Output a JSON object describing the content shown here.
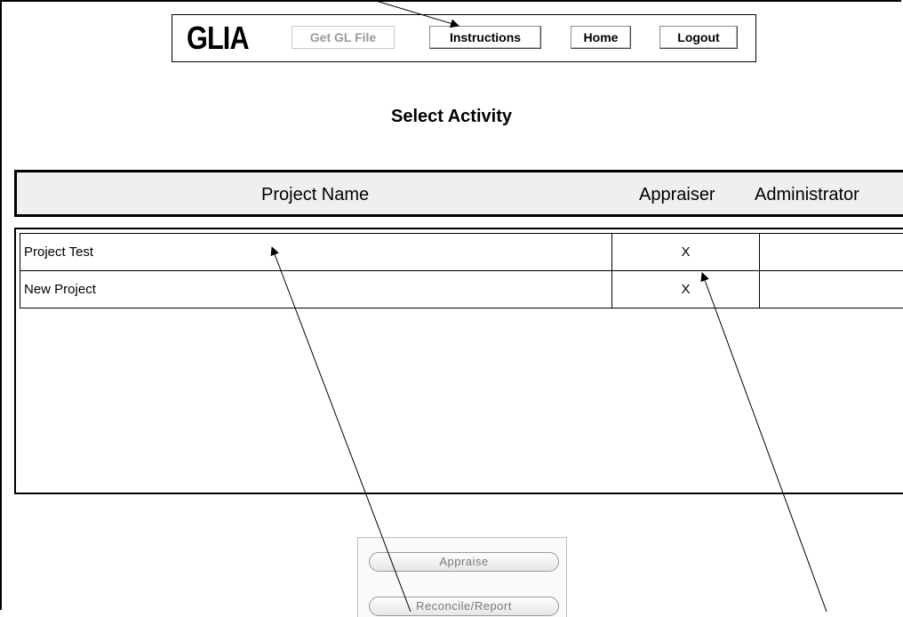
{
  "nav": {
    "logo": "GLIA",
    "get_gl_file": "Get GL File",
    "instructions": "Instructions",
    "home": "Home",
    "logout": "Logout"
  },
  "page_title": "Select Activity",
  "table": {
    "columns": [
      "Project Name",
      "Appraiser",
      "Administrator"
    ],
    "rows": [
      {
        "name": "Project Test",
        "appraiser": "X",
        "administrator": ""
      },
      {
        "name": "New Project",
        "appraiser": "X",
        "administrator": ""
      }
    ]
  },
  "actions": {
    "appraise": "Appraise",
    "reconcile": "Reconcile/Report"
  }
}
